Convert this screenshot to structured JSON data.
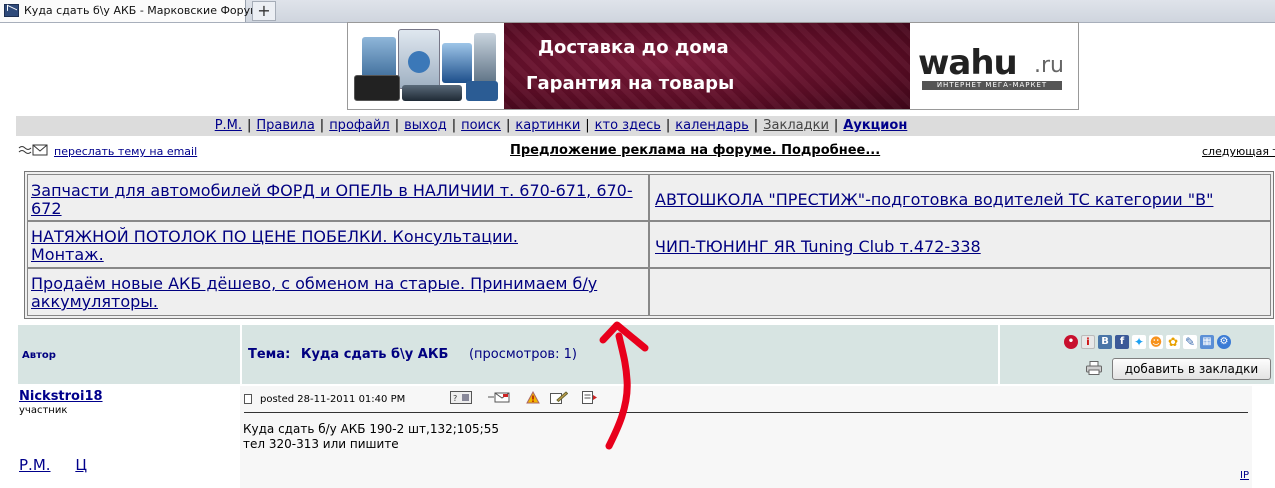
{
  "browser": {
    "tab_title": "Куда сдать б\\у АКБ - Марковские Форумы",
    "new_tab_label": "+"
  },
  "banner": {
    "line1": "Доставка до дома",
    "line2": "Гарантия на товары",
    "brand": "wahu",
    "brand_tld": ".ru",
    "brand_sub": "ИНТЕРНЕТ МЕГА-МАРКЕТ",
    "bg_color": "#5c0d26"
  },
  "nav": {
    "links": [
      "Р.М.",
      "Правила",
      "профайл",
      "выход",
      "поиск",
      "картинки",
      "кто здесь",
      "календарь",
      "Закладки",
      "Аукцион"
    ]
  },
  "info": {
    "forward_email": "переслать тему на email",
    "ad_offer": "Предложение реклама на форуме. Подробнее...",
    "next_topic": "следующая те"
  },
  "ads": [
    "Запчасти для автомобилей ФОРД и ОПЕЛЬ в НАЛИЧИИ т. 670-671, 670-672",
    "АВТОШКОЛА \"ПРЕСТИЖ\"-подготовка водителей ТС категории \"В\"",
    "НАТЯЖНОЙ ПОТОЛОК ПО ЦЕНЕ ПОБЕЛКИ. Консультации. Монтаж.",
    "ЧИП-ТЮНИНГ ЯR Tuning Club т.472-338",
    "Продаём новые АКБ дёшево, с обменом на старые. Принимаем б/у аккумуляторы.",
    ""
  ],
  "post_header": {
    "author_col": "Автор",
    "topic_label": "Тема:",
    "topic_title": "Куда сдать б\\у АКБ",
    "views": "(просмотров: 1)",
    "bookmark_button": "добавить в закладки",
    "social_icons": [
      "share-icon",
      "info-icon",
      "vk-icon",
      "facebook-icon",
      "twitter-icon",
      "odnoklassniki-icon",
      "moimir-icon",
      "livejournal-icon",
      "liveinternet-icon",
      "settings-icon"
    ]
  },
  "post": {
    "author": "Nickstroi18",
    "role": "участник",
    "posted": "posted 28-11-2011 01:40 PM",
    "line1": "Куда сдать б/у АКБ 190-2 шт,132;105;55",
    "line2": "тел 320-313 или пишите",
    "pm_link": "Р.М.",
    "quote_link": "Ц",
    "ip_link": "IP",
    "action_icons": [
      "profile-icon",
      "message-icon",
      "report-icon",
      "edit-icon",
      "quote-icon"
    ]
  },
  "colors": {
    "link": "#00008b",
    "header_bg": "#d7e4e2",
    "annotation": "#e8001c"
  }
}
